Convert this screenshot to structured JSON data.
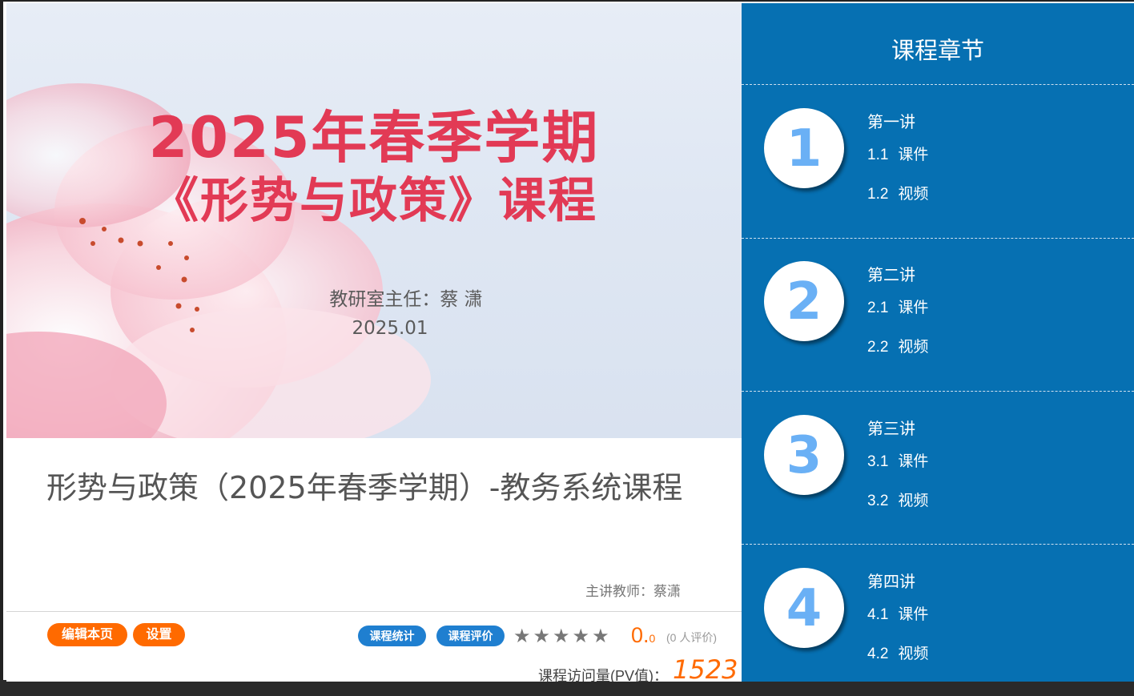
{
  "banner": {
    "title_line1": "2025年春季学期",
    "title_line2": "《形势与政策》课程",
    "director": "教研室主任：蔡  潇",
    "date": "2025.01"
  },
  "course": {
    "title": "形势与政策（2025年春季学期）-教务系统课程",
    "teacher": "主讲教师：蔡潇"
  },
  "actions": {
    "edit_label": "编辑本页",
    "settings_label": "设置",
    "stats_label": "课程统计",
    "review_label": "课程评价"
  },
  "rating": {
    "stars_filled": 0,
    "stars_total": 5,
    "score_main": "0.",
    "score_decimal": "0",
    "review_count": "(0 人评价)"
  },
  "pv": {
    "label": "课程访问量(PV值)：",
    "value": "1523"
  },
  "chapters_panel": {
    "title": "课程章节",
    "chapters": [
      {
        "number": "1",
        "name": "第一讲",
        "items": [
          {
            "num": "1.1",
            "label": "课件"
          },
          {
            "num": "1.2",
            "label": "视频"
          }
        ]
      },
      {
        "number": "2",
        "name": "第二讲",
        "items": [
          {
            "num": "2.1",
            "label": "课件"
          },
          {
            "num": "2.2",
            "label": "视频"
          }
        ]
      },
      {
        "number": "3",
        "name": "第三讲",
        "items": [
          {
            "num": "3.1",
            "label": "课件"
          },
          {
            "num": "3.2",
            "label": "视频"
          }
        ]
      },
      {
        "number": "4",
        "name": "第四讲",
        "items": [
          {
            "num": "4.1",
            "label": "课件"
          },
          {
            "num": "4.2",
            "label": "视频"
          }
        ]
      }
    ]
  },
  "colors": {
    "panel_blue": "#0670b2",
    "accent_orange": "#ff6a00",
    "button_blue": "#1f7fd0",
    "banner_red": "#e23a55",
    "circle_number": "#6ab0f5"
  }
}
